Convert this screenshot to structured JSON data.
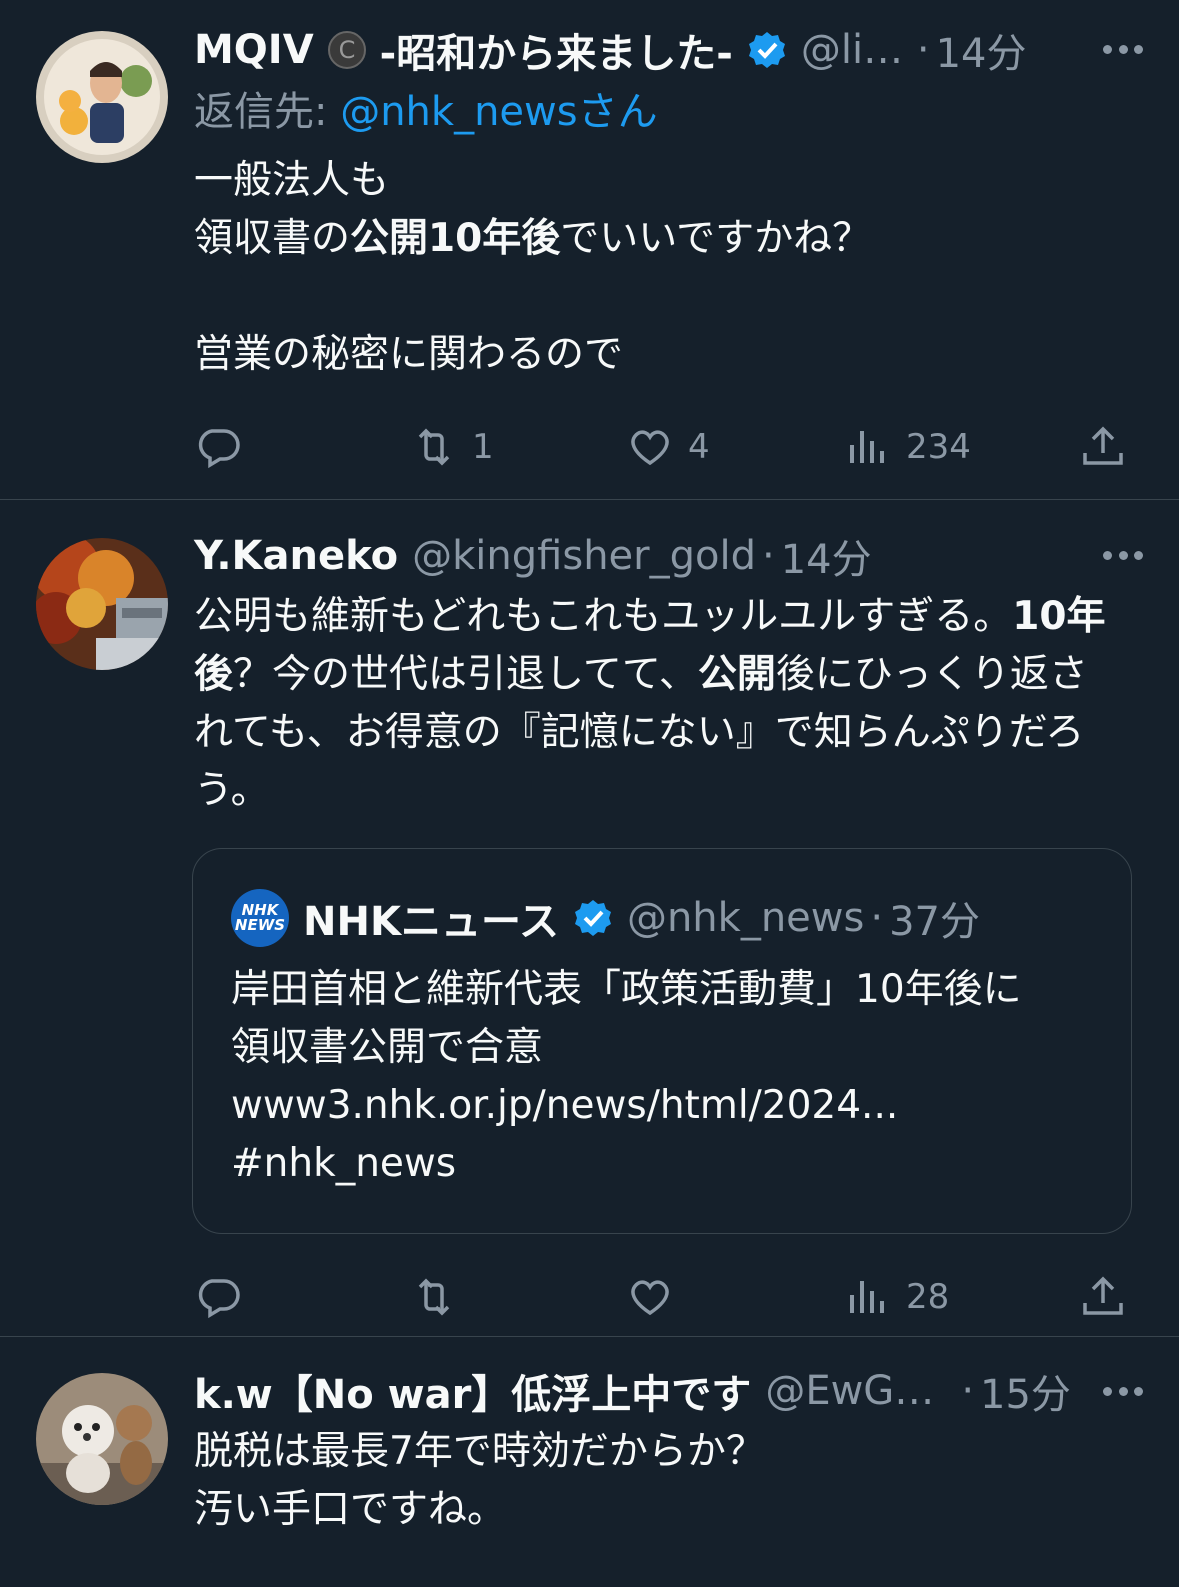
{
  "tweets": [
    {
      "name": "MQIV",
      "name_suffix": "-昭和から来ました-",
      "handle": "@lil...",
      "time": "14分",
      "reply_label": "返信先:",
      "reply_handle": "@nhk_news",
      "reply_suffix": "さん",
      "text_line1": "一般法人も",
      "text_line2_pre": "領収書の",
      "text_line2_bold": "公開10年後",
      "text_line2_post": "でいいですかね？",
      "text_line3": "営業の秘密に関わるので",
      "retweets": "1",
      "likes": "4",
      "views": "234"
    },
    {
      "name": "Y.Kaneko",
      "handle": "@kingfisher_gold",
      "time": "14分",
      "text_a": "公明も維新もどれもこれもユッルユルすぎる。",
      "text_b_bold": "10年後",
      "text_c": "？今の世代は引退してて、",
      "text_d_bold": "公開",
      "text_e": "後にひっくり返されても、お得意の『記憶にない』で知らんぷりだろう。",
      "quote": {
        "avatar_line1": "NHK",
        "avatar_line2": "NEWS",
        "name": "NHKニュース",
        "handle": "@nhk_news",
        "time": "37分",
        "text": "岸田首相と維新代表「政策活動費」10年後に\n領収書公開で合意\nwww3.nhk.or.jp/news/html/2024...\n#nhk_news"
      },
      "views": "28"
    },
    {
      "name": "k.w【No war】低浮上中です",
      "handle": "@EwGk...",
      "time": "15分",
      "text": "脱税は最長7年で時効だからか？\n汚い手口ですね。"
    }
  ],
  "dot": "·",
  "colors": {
    "background": "#15202b",
    "muted": "#8b98a5",
    "link": "#1d9bf0",
    "verified": "#1d9bf0"
  },
  "icons": [
    "reply-icon",
    "retweet-icon",
    "like-icon",
    "views-icon",
    "share-icon",
    "more-icon",
    "verified-badge-icon",
    "copyright-icon"
  ]
}
